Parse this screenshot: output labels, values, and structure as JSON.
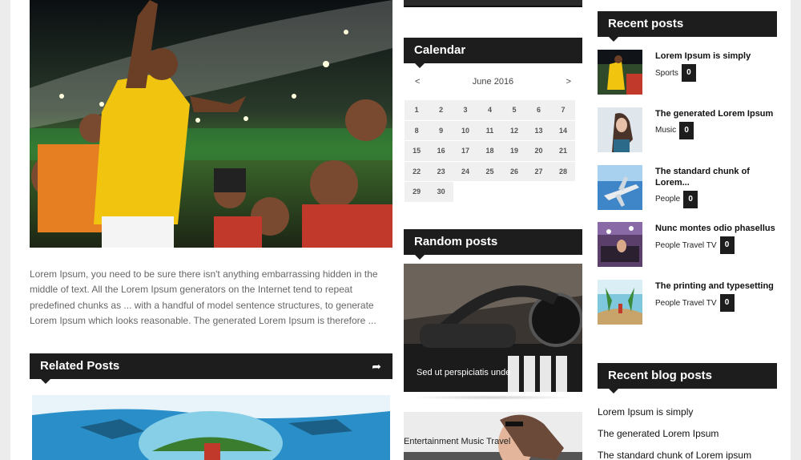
{
  "main": {
    "excerpt": "Lorem Ipsum, you need to be sure there isn't anything embarrassing hidden in the middle of text. All the Lorem Ipsum generators on the Internet tend to repeat predefined chunks as ... with a handful of model sentence structures, to generate Lorem Ipsum which looks reasonable. The generated Lorem Ipsum is therefore ...",
    "related_title": "Related Posts",
    "share_icon": "share-icon",
    "share_glyph": "➦"
  },
  "calendar": {
    "title": "Calendar",
    "month": "June 2016",
    "prev": "<",
    "next": ">",
    "days": [
      "1",
      "2",
      "3",
      "4",
      "5",
      "6",
      "7",
      "8",
      "9",
      "10",
      "11",
      "12",
      "13",
      "14",
      "15",
      "16",
      "17",
      "18",
      "19",
      "20",
      "21",
      "22",
      "23",
      "24",
      "25",
      "26",
      "27",
      "28",
      "29",
      "30"
    ]
  },
  "random": {
    "title": "Random posts",
    "post_title": "Sed ut perspiciatis unde",
    "post2_category": "Entertainment Music Travel"
  },
  "recent": {
    "title": "Recent posts",
    "items": [
      {
        "title": "Lorem Ipsum is simply",
        "category": "Sports",
        "count": "0"
      },
      {
        "title": "The generated Lorem Ipsum",
        "category": "Music",
        "count": "0"
      },
      {
        "title": "The standard chunk of Lorem...",
        "category": "People",
        "count": "0"
      },
      {
        "title": "Nunc montes odio phasellus",
        "category": "People Travel TV",
        "count": "0"
      },
      {
        "title": "The printing and typesetting",
        "category": "People Travel TV",
        "count": "0"
      }
    ]
  },
  "blog": {
    "title": "Recent blog posts",
    "items": [
      "Lorem Ipsum is simply",
      "The generated Lorem Ipsum",
      "The standard chunk of Lorem ipsum"
    ]
  },
  "colors": {
    "widget_header_bg": "#1d1d1d",
    "calendar_cell_bg": "#f0f0f0",
    "page_bg": "#ececec"
  }
}
